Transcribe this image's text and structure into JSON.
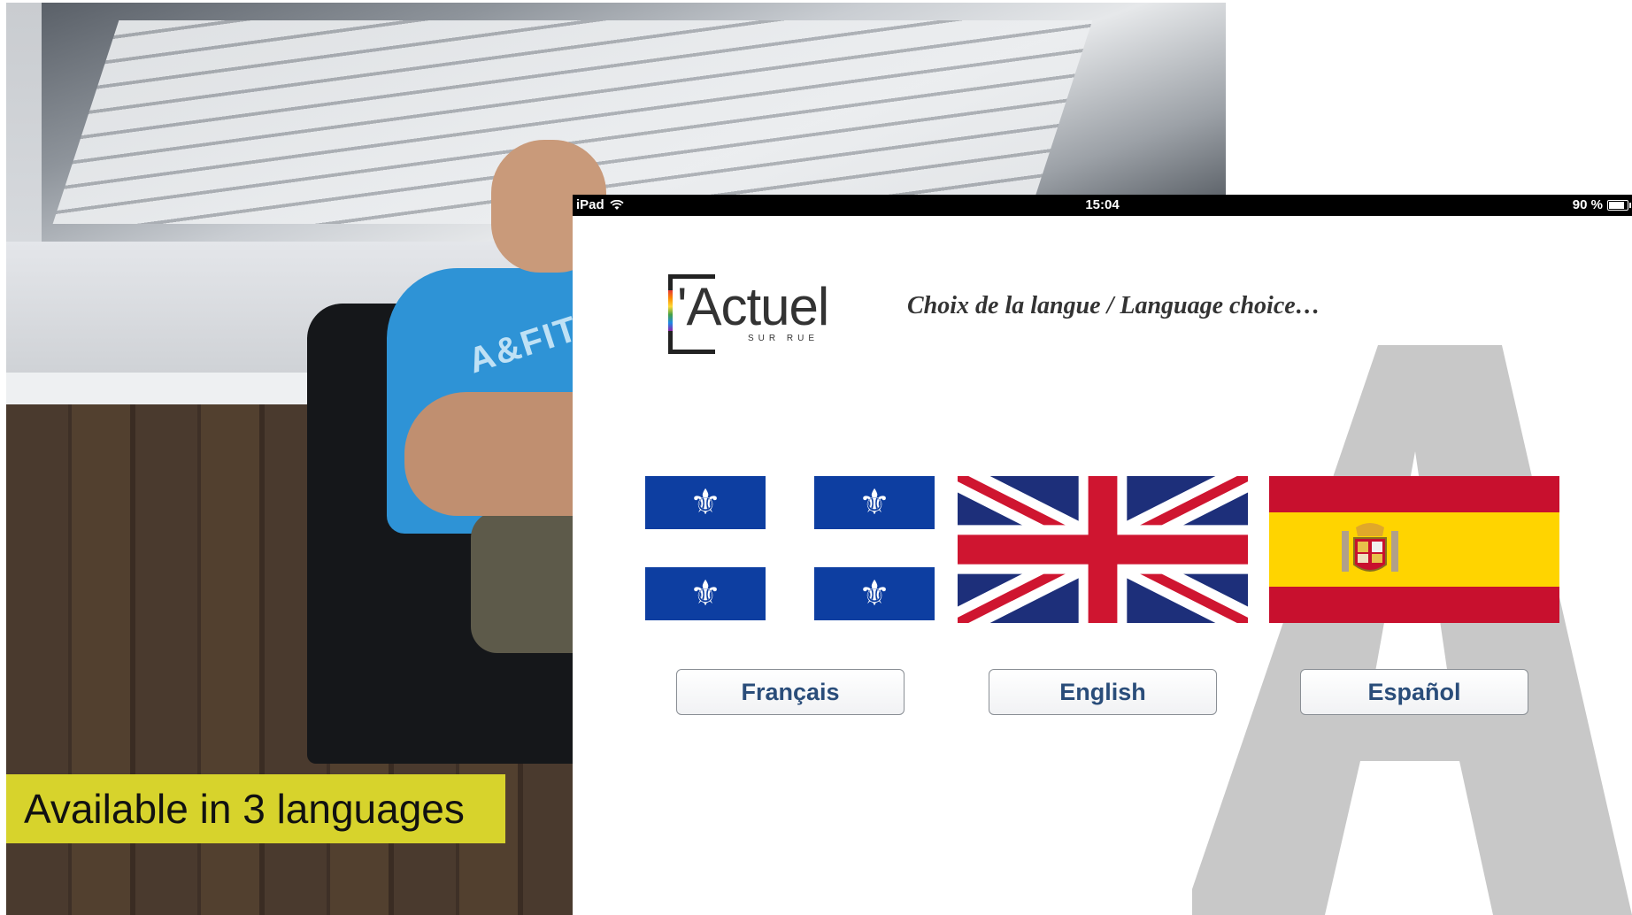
{
  "caption": "Available in 3 languages",
  "photo": {
    "shirt_print": "A&FITC"
  },
  "status_bar": {
    "device": "iPad",
    "time": "15:04",
    "battery": "90 %"
  },
  "logo": {
    "word": "'Actuel",
    "sub": "SUR RUE"
  },
  "title": "Choix de la langue / Language choice…",
  "languages": [
    {
      "label": "Français",
      "flag": "quebec-flag"
    },
    {
      "label": "English",
      "flag": "uk-flag"
    },
    {
      "label": "Español",
      "flag": "spain-flag"
    }
  ],
  "colors": {
    "caption_bg": "#d7d32c",
    "button_text": "#2a4d7a",
    "quebec_blue": "#0d3ea1",
    "uk_blue": "#1d2f7a",
    "uk_red": "#cf1530",
    "spain_red": "#c8102e",
    "spain_yellow": "#ffd400",
    "watermark": "#c8c8c8"
  }
}
